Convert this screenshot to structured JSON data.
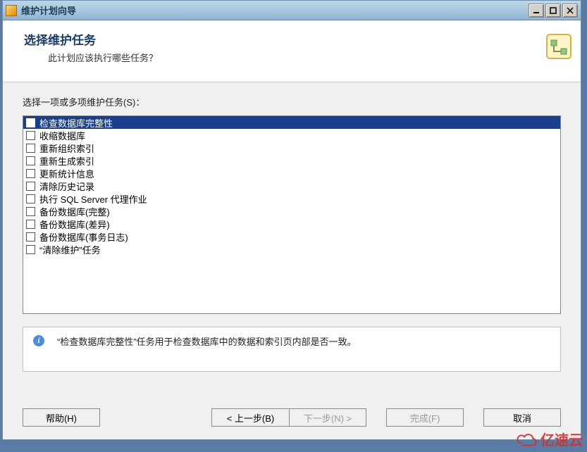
{
  "window": {
    "title": "维护计划向导"
  },
  "header": {
    "title": "选择维护任务",
    "subtitle": "此计划应该执行哪些任务？"
  },
  "prompt": "选择一项或多项维护任务(S)：",
  "tasks": [
    {
      "label": "检查数据库完整性",
      "selected": true
    },
    {
      "label": "收缩数据库",
      "selected": false
    },
    {
      "label": "重新组织索引",
      "selected": false
    },
    {
      "label": "重新生成索引",
      "selected": false
    },
    {
      "label": "更新统计信息",
      "selected": false
    },
    {
      "label": "清除历史记录",
      "selected": false
    },
    {
      "label": "执行 SQL Server 代理作业",
      "selected": false
    },
    {
      "label": "备份数据库(完整)",
      "selected": false
    },
    {
      "label": "备份数据库(差异)",
      "selected": false
    },
    {
      "label": "备份数据库(事务日志)",
      "selected": false
    },
    {
      "label": "“清除维护”任务",
      "selected": false
    }
  ],
  "description": "“检查数据库完整性”任务用于检查数据库中的数据和索引页内部是否一致。",
  "buttons": {
    "help": "帮助(H)",
    "back": "< 上一步(B)",
    "next": "下一步(N) >",
    "finish": "完成(F)",
    "cancel": "取消"
  },
  "watermark": "亿速云"
}
